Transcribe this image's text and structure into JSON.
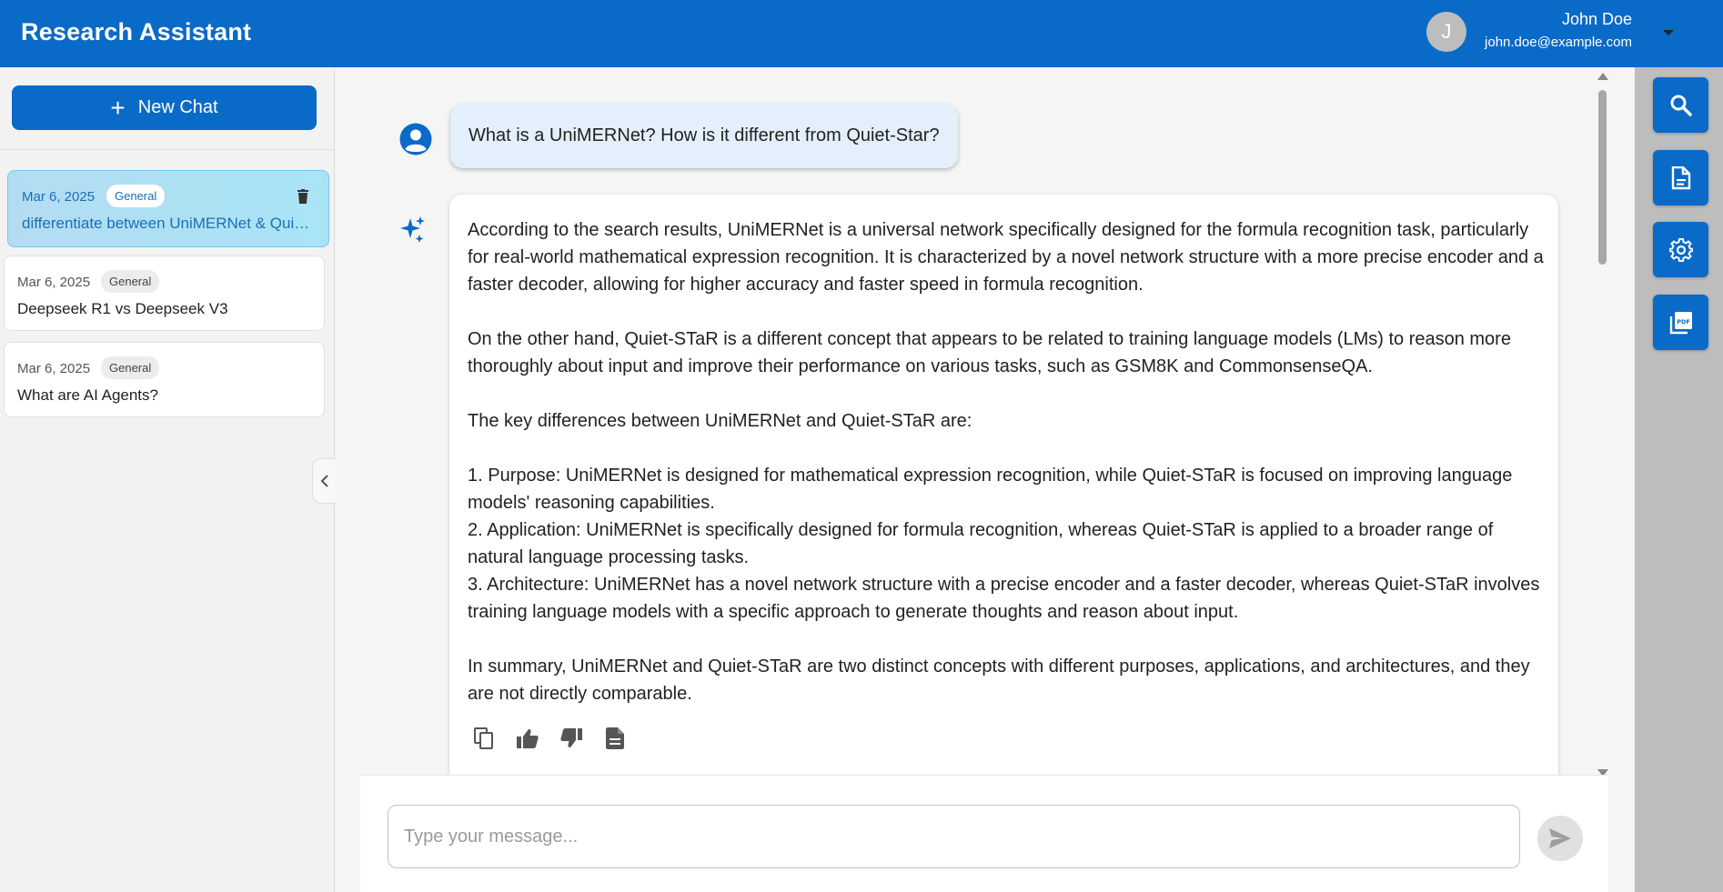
{
  "header": {
    "title": "Research Assistant",
    "user": {
      "initial": "J",
      "name": "John Doe",
      "email": "john.doe@example.com"
    }
  },
  "sidebar": {
    "new_chat_label": "New Chat",
    "chats": [
      {
        "date": "Mar 6, 2025",
        "tag": "General",
        "title": "differentiate between UniMERNet & Quiet-Star",
        "active": true
      },
      {
        "date": "Mar 6, 2025",
        "tag": "General",
        "title": "Deepseek R1 vs Deepseek V3",
        "active": false
      },
      {
        "date": "Mar 6, 2025",
        "tag": "General",
        "title": "What are AI Agents?",
        "active": false
      }
    ]
  },
  "conversation": {
    "user_message": "What is a UniMERNet? How is it different from Quiet-Star?",
    "assistant_message": "According to the search results, UniMERNet is a universal network specifically designed for the formula recognition task, particularly for real-world mathematical expression recognition. It is characterized by a novel network structure with a more precise encoder and a faster decoder, allowing for higher accuracy and faster speed in formula recognition.\n\nOn the other hand, Quiet-STaR is a different concept that appears to be related to training language models (LMs) to reason more thoroughly about input and improve their performance on various tasks, such as GSM8K and CommonsenseQA.\n\nThe key differences between UniMERNet and Quiet-STaR are:\n\n1. Purpose: UniMERNet is designed for mathematical expression recognition, while Quiet-STaR is focused on improving language models' reasoning capabilities.\n2. Application: UniMERNet is specifically designed for formula recognition, whereas Quiet-STaR is applied to a broader range of natural language processing tasks.\n3. Architecture: UniMERNet has a novel network structure with a precise encoder and a faster decoder, whereas Quiet-STaR involves training language models with a specific approach to generate thoughts and reason about input.\n\nIn summary, UniMERNet and Quiet-STaR are two distinct concepts with different purposes, applications, and architectures, and they are not directly comparable.",
    "actions": [
      "copy-icon",
      "thumbs-up-icon",
      "thumbs-down-icon",
      "document-icon"
    ]
  },
  "composer": {
    "placeholder": "Type your message..."
  },
  "tools": [
    "search-icon",
    "document-icon",
    "settings-icon",
    "pdf-icon"
  ],
  "colors": {
    "primary": "#0a6ac7",
    "active_chat": "#b3dcf2",
    "user_bubble": "#e3f0fb",
    "tool_rail": "#bdbdbd"
  }
}
